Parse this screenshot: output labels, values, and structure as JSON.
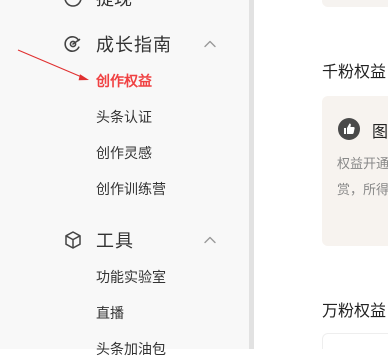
{
  "sidebar": {
    "top_partial": {
      "label": "提现",
      "icon": "clock-icon"
    },
    "groups": [
      {
        "label": "成长指南",
        "icon": "growth-icon",
        "expanded": true,
        "items": [
          {
            "label": "创作权益",
            "active": true
          },
          {
            "label": "头条认证",
            "active": false
          },
          {
            "label": "创作灵感",
            "active": false
          },
          {
            "label": "创作训练营",
            "active": false
          }
        ]
      },
      {
        "label": "工具",
        "icon": "cube-icon",
        "expanded": true,
        "items": [
          {
            "label": "功能实验室",
            "active": false
          },
          {
            "label": "直播",
            "active": false
          },
          {
            "label": "头条加油包",
            "active": false
          }
        ]
      }
    ]
  },
  "annotation": {
    "type": "arrow",
    "color": "#e03030",
    "target": "创作权益"
  },
  "main": {
    "sections": [
      {
        "title": "千粉权益",
        "card": {
          "icon": "thumbs-up-icon",
          "title": "图",
          "desc_lines": [
            "权益开通",
            "赏，所得"
          ]
        }
      },
      {
        "title": "万粉权益"
      }
    ]
  },
  "colors": {
    "sidebar_bg": "#f8f8f8",
    "active_item": "#f04142",
    "text": "#333333",
    "card_bg": "#f7f3ef",
    "divider": "#e2e2e2"
  }
}
